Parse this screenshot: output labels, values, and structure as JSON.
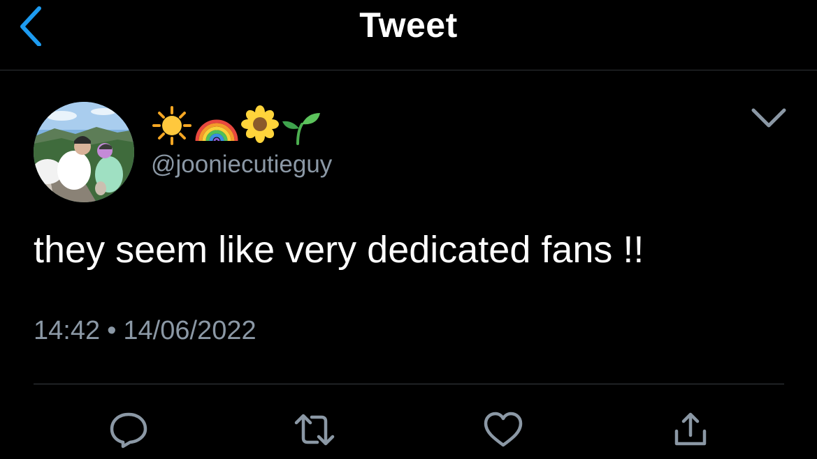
{
  "header": {
    "title": "Tweet",
    "back_icon": "chevron-left-icon"
  },
  "tweet": {
    "display_name_icons": [
      "sun-icon",
      "rainbow-icon",
      "sunflower-icon",
      "seedling-icon"
    ],
    "username": "@jooniecutieguy",
    "text": "they seem like very dedicated fans !!",
    "time": "14:42",
    "separator": "•",
    "date": "14/06/2022"
  },
  "actions": [
    "reply-icon",
    "retweet-icon",
    "like-icon",
    "share-icon"
  ],
  "colors": {
    "background": "#000000",
    "accent": "#1d9bf0",
    "secondary_text": "#8b98a5",
    "icon": "#8b98a5"
  }
}
